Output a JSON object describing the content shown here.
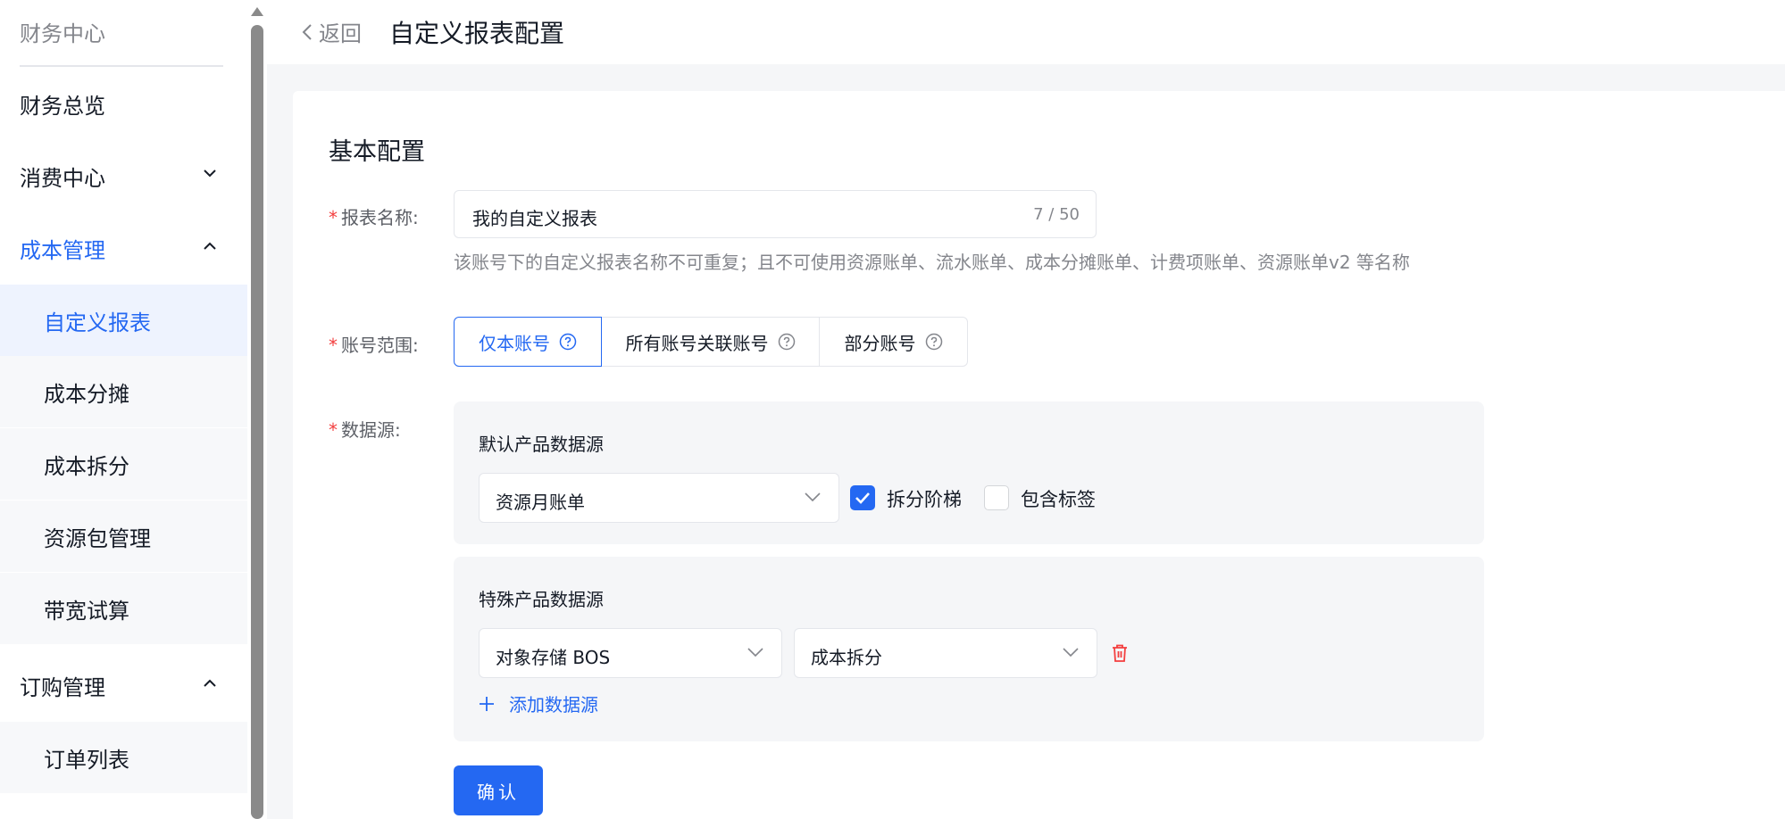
{
  "sidebar": {
    "top_title": "财务中心",
    "items": [
      {
        "label": "财务总览"
      },
      {
        "label": "消费中心"
      },
      {
        "label": "成本管理"
      },
      {
        "label": "自定义报表"
      },
      {
        "label": "成本分摊"
      },
      {
        "label": "成本拆分"
      },
      {
        "label": "资源包管理"
      },
      {
        "label": "带宽试算"
      },
      {
        "label": "订购管理"
      },
      {
        "label": "订单列表"
      }
    ]
  },
  "header": {
    "back_label": "返回",
    "title": "自定义报表配置"
  },
  "form": {
    "section_title": "基本配置",
    "name": {
      "label": "报表名称:",
      "value": "我的自定义报表",
      "counter": "7 / 50",
      "hint": "该账号下的自定义报表名称不可重复；且不可使用资源账单、流水账单、成本分摊账单、计费项账单、资源账单v2 等名称"
    },
    "scope": {
      "label": "账号范围:",
      "options": [
        {
          "label": "仅本账号",
          "selected": true
        },
        {
          "label": "所有账号关联账号",
          "selected": false
        },
        {
          "label": "部分账号",
          "selected": false
        }
      ]
    },
    "datasource": {
      "label": "数据源:",
      "default_title": "默认产品数据源",
      "default_select": "资源月账单",
      "split_tier_label": "拆分阶梯",
      "split_tier_checked": true,
      "include_tags_label": "包含标签",
      "include_tags_checked": false,
      "special_title": "特殊产品数据源",
      "special_product": "对象存储 BOS",
      "special_type": "成本拆分",
      "add_label": "添加数据源"
    },
    "confirm_label": "确认"
  },
  "colors": {
    "accent": "#2468f2",
    "required": "#f33e3e",
    "delete": "#f33e3e"
  }
}
